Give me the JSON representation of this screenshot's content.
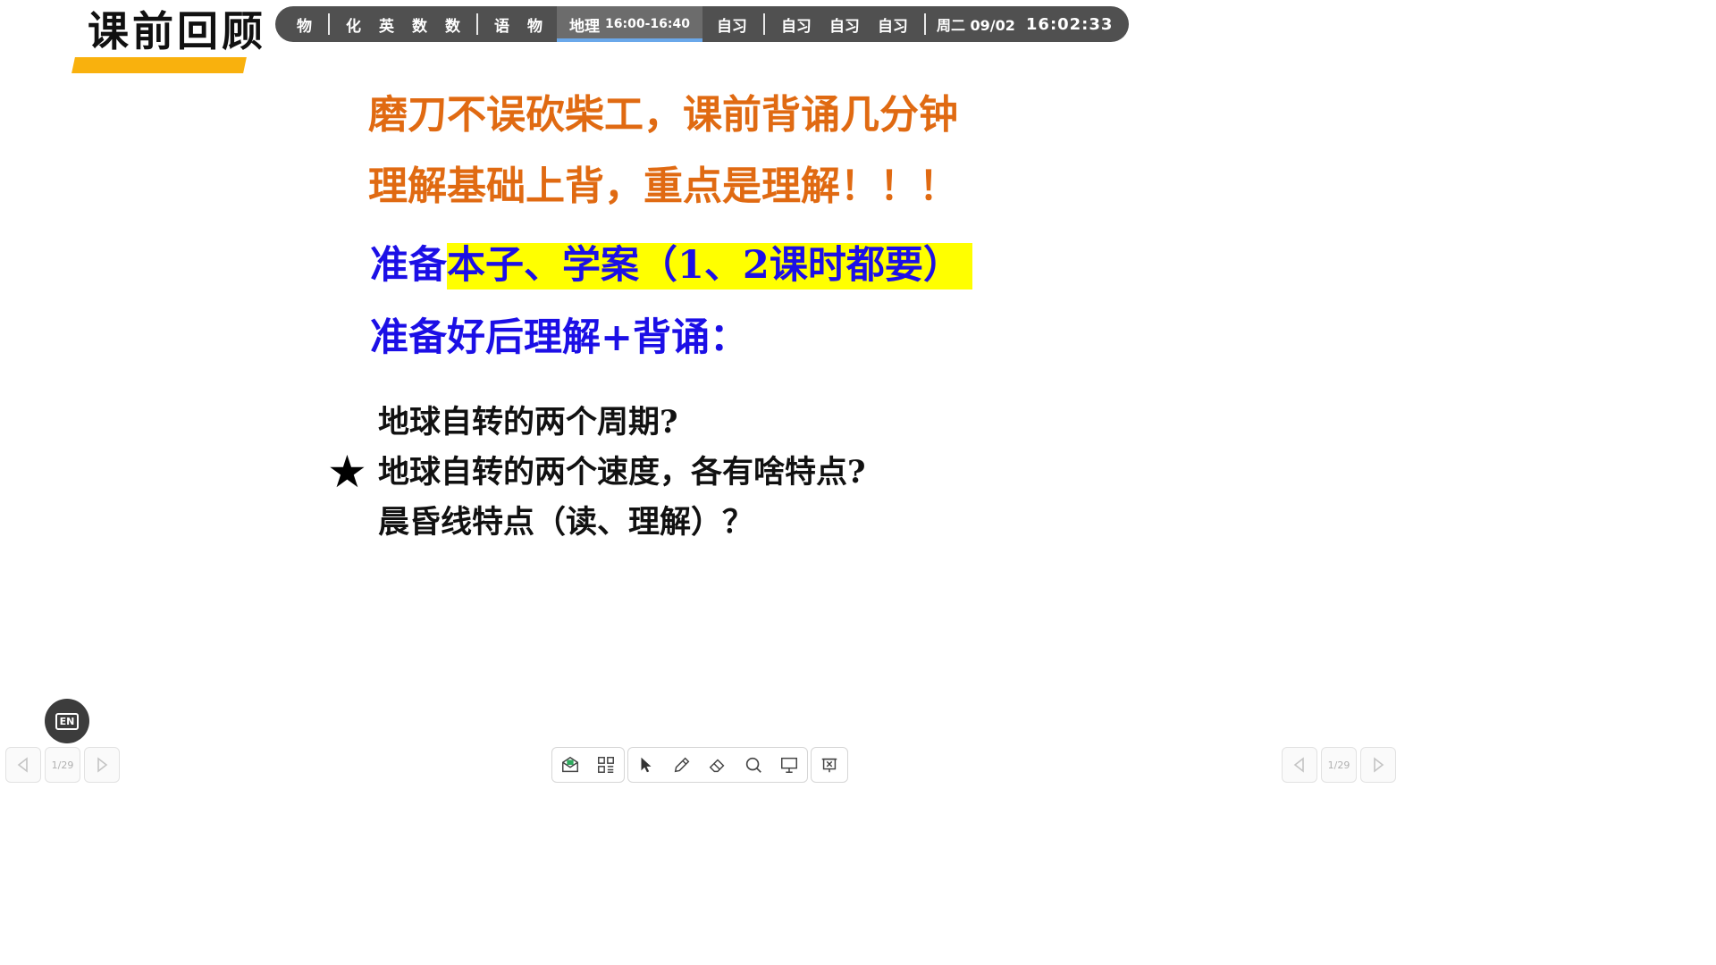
{
  "header": {
    "title": "课前回顾"
  },
  "schedule": {
    "group1": [
      "物"
    ],
    "group2": [
      "化",
      "英",
      "数",
      "数"
    ],
    "group3": [
      "语",
      "物"
    ],
    "current": {
      "subject": "地理",
      "time": "16:00-16:40"
    },
    "group4": [
      "自习"
    ],
    "group5": [
      "自习",
      "自习",
      "自习"
    ],
    "date": "周二 09/02",
    "clock": "16:02:33"
  },
  "slide": {
    "line1": "磨刀不误砍柴工，课前背诵几分钟",
    "line2": "理解基础上背，重点是理解！！！",
    "line3_prefix": "准备",
    "line3_highlight": "本子、学案（1、2课时都要）",
    "line4": "准备好后理解+背诵：",
    "questions": [
      "地球自转的两个周期?",
      "地球自转的两个速度，各有啥特点?",
      "晨昏线特点（读、理解）？"
    ],
    "star": "★"
  },
  "controls": {
    "en_label": "EN",
    "left_page": "1/29",
    "right_page": "1/29",
    "icons": {
      "prev": "chevron-left-icon",
      "next": "chevron-right-icon",
      "tools": [
        "envelope-icon",
        "apps-grid-icon",
        "pointer-icon",
        "pen-icon",
        "eraser-icon",
        "search-icon",
        "presentation-icon",
        "close-box-icon"
      ]
    }
  }
}
